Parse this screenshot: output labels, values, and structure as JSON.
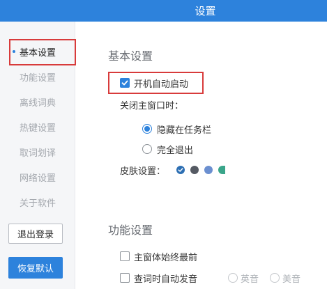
{
  "window": {
    "title": "设置"
  },
  "sidebar": {
    "items": [
      {
        "label": "基本设置",
        "active": true
      },
      {
        "label": "功能设置"
      },
      {
        "label": "离线词典"
      },
      {
        "label": "热键设置"
      },
      {
        "label": "取词划译"
      },
      {
        "label": "网络设置"
      },
      {
        "label": "关于软件"
      }
    ],
    "logout_label": "退出登录",
    "restore_label": "恢复默认"
  },
  "basic": {
    "title": "基本设置",
    "autostart_label": "开机自动启动",
    "autostart_checked": true,
    "close_main_label": "关闭主窗口时：",
    "close_options": [
      {
        "label": "隐藏在任务栏",
        "selected": true
      },
      {
        "label": "完全退出",
        "selected": false
      }
    ],
    "skin_label": "皮肤设置：",
    "skins": [
      "#2d6fb3",
      "#555a63",
      "#6b8fd0",
      "#3aa58a"
    ]
  },
  "features": {
    "title": "功能设置",
    "always_top_label": "主窗体始终最前",
    "auto_speak_label": "查词时自动发音",
    "voice_options": [
      "英音",
      "美音"
    ]
  },
  "colors": {
    "accent": "#2d82dc",
    "highlight": "#d83b3b"
  }
}
